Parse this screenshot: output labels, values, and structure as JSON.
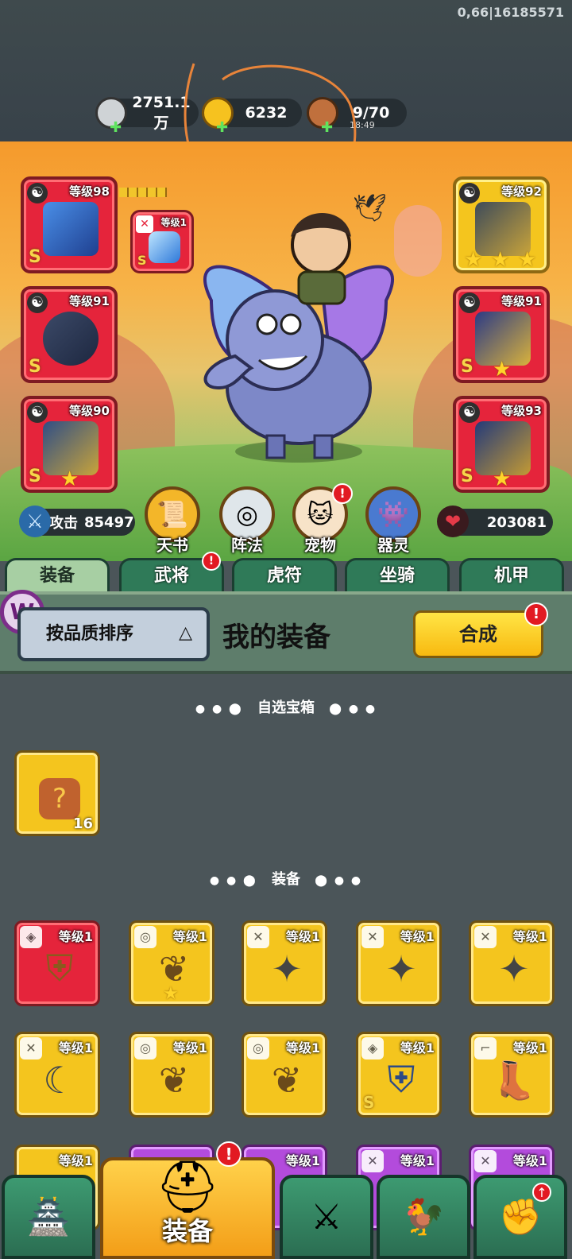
{
  "debug_text": "0,66|16185571",
  "resources": [
    {
      "icon": "silver-coin-icon",
      "value": "2751.1万",
      "sub": ""
    },
    {
      "icon": "gold-ingot-icon",
      "value": "6232",
      "sub": ""
    },
    {
      "icon": "meat-stamina-icon",
      "value": "9/70",
      "sub": "18:49"
    }
  ],
  "equip_slots": {
    "left": [
      {
        "level": "等级98",
        "grade": "S",
        "stars": 0
      },
      {
        "level": "等级91",
        "grade": "S",
        "stars": 0
      },
      {
        "level": "等级90",
        "grade": "S",
        "stars": 1
      }
    ],
    "right": [
      {
        "level": "等级92",
        "grade": "",
        "stars": 3
      },
      {
        "level": "等级91",
        "grade": "S",
        "stars": 1
      },
      {
        "level": "等级93",
        "grade": "S",
        "stars": 1
      }
    ],
    "small": {
      "level": "等级1",
      "grade": "S"
    }
  },
  "stats": {
    "attack_label": "攻击",
    "attack_value": "85497",
    "hp_value": "203081"
  },
  "functions": [
    {
      "label": "天书",
      "icon": "scroll-icon",
      "badge": ""
    },
    {
      "label": "阵法",
      "icon": "formation-icon",
      "badge": ""
    },
    {
      "label": "宠物",
      "icon": "cat-pet-icon",
      "badge": "!"
    },
    {
      "label": "器灵",
      "icon": "spirit-icon",
      "badge": ""
    }
  ],
  "tabs": [
    {
      "label": "装备",
      "badge": ""
    },
    {
      "label": "武将",
      "badge": "!"
    },
    {
      "label": "虎符",
      "badge": ""
    },
    {
      "label": "坐骑",
      "badge": ""
    },
    {
      "label": "机甲",
      "badge": ""
    }
  ],
  "sort_label": "按品质排序",
  "my_equipment_title": "我的装备",
  "synth_label": "合成",
  "watermark": "W",
  "section_chest": "自选宝箱",
  "chest_count": "16",
  "chest_mark": "?",
  "section_equip": "装备",
  "items": [
    {
      "level": "等级1",
      "color": "red",
      "glyph": "armor-icon",
      "star": false,
      "grade": ""
    },
    {
      "level": "等级1",
      "color": "gold",
      "glyph": "amulet-icon",
      "star": true,
      "grade": ""
    },
    {
      "level": "等级1",
      "color": "gold",
      "glyph": "shuriken-icon",
      "star": false,
      "grade": ""
    },
    {
      "level": "等级1",
      "color": "gold",
      "glyph": "shuriken-icon",
      "star": false,
      "grade": ""
    },
    {
      "level": "等级1",
      "color": "gold",
      "glyph": "shuriken-icon",
      "star": false,
      "grade": ""
    },
    {
      "level": "等级1",
      "color": "gold",
      "glyph": "dagger-icon",
      "star": false,
      "grade": ""
    },
    {
      "level": "等级1",
      "color": "gold",
      "glyph": "amulet-icon",
      "star": false,
      "grade": ""
    },
    {
      "level": "等级1",
      "color": "gold",
      "glyph": "amulet-icon",
      "star": false,
      "grade": ""
    },
    {
      "level": "等级1",
      "color": "gold",
      "glyph": "chest-armor-icon",
      "star": false,
      "grade": "S"
    },
    {
      "level": "等级1",
      "color": "gold",
      "glyph": "boots-icon",
      "star": false,
      "grade": ""
    },
    {
      "level": "等级1",
      "color": "gold",
      "glyph": "",
      "star": false,
      "grade": ""
    },
    {
      "level": "",
      "color": "purple",
      "glyph": "",
      "star": false,
      "grade": ""
    },
    {
      "level": "等级1",
      "color": "purple",
      "glyph": "",
      "star": false,
      "grade": ""
    },
    {
      "level": "等级1",
      "color": "purple",
      "glyph": "",
      "star": false,
      "grade": ""
    },
    {
      "level": "等级1",
      "color": "purple",
      "glyph": "",
      "star": false,
      "grade": ""
    }
  ],
  "bottom_nav": [
    {
      "label": "",
      "icon": "castle-gate-icon",
      "active": false
    },
    {
      "label": "装备",
      "icon": "helmet-icon",
      "active": true
    },
    {
      "label": "",
      "icon": "crossed-swords-icon",
      "active": false
    },
    {
      "label": "",
      "icon": "chicken-icon",
      "active": false
    },
    {
      "label": "",
      "icon": "fist-upgrade-icon",
      "active": false
    }
  ],
  "colors": {
    "accent_gold": "#f4c51e",
    "accent_red": "#e5243b",
    "tab_green": "#2f7a58",
    "background": "#4b5559"
  }
}
